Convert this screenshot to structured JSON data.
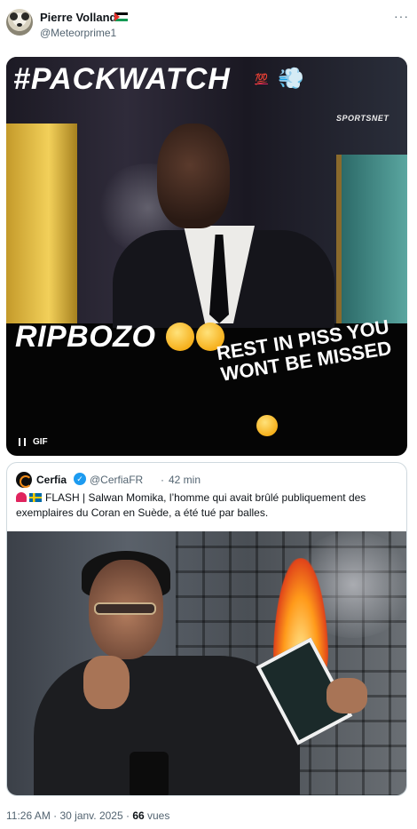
{
  "author": {
    "name": "Pierre Volland",
    "handle": "@Meteorprime1",
    "flag_icon": "palestine-flag-icon"
  },
  "more_menu": "···",
  "gif": {
    "caption_top": "#PACKWATCH",
    "emoji_100": "💯",
    "emoji_puff": "💨",
    "caption_mid": "RIPBOZO",
    "emoji_laugh": "rolling-on-floor-laughing-icon",
    "caption_bottom": "REST IN PISS YOU WONT BE MISSED",
    "watermark": "SPORTSNET",
    "small_text": "🤣🤣",
    "badge": "GIF",
    "control": "pause"
  },
  "quote": {
    "name": "Cerfia",
    "handle": "@CerfiaFR",
    "separator": "·",
    "time": "42 min",
    "text": "FLASH | Salwan Momika, l’homme qui avait brûlé publiquement des exemplaires du Coran en Suède, a été tué par balles."
  },
  "footer": {
    "timestamp": "11:26 AM · 30 janv. 2025 · ",
    "views_count": "66",
    "views_label": " vues"
  }
}
